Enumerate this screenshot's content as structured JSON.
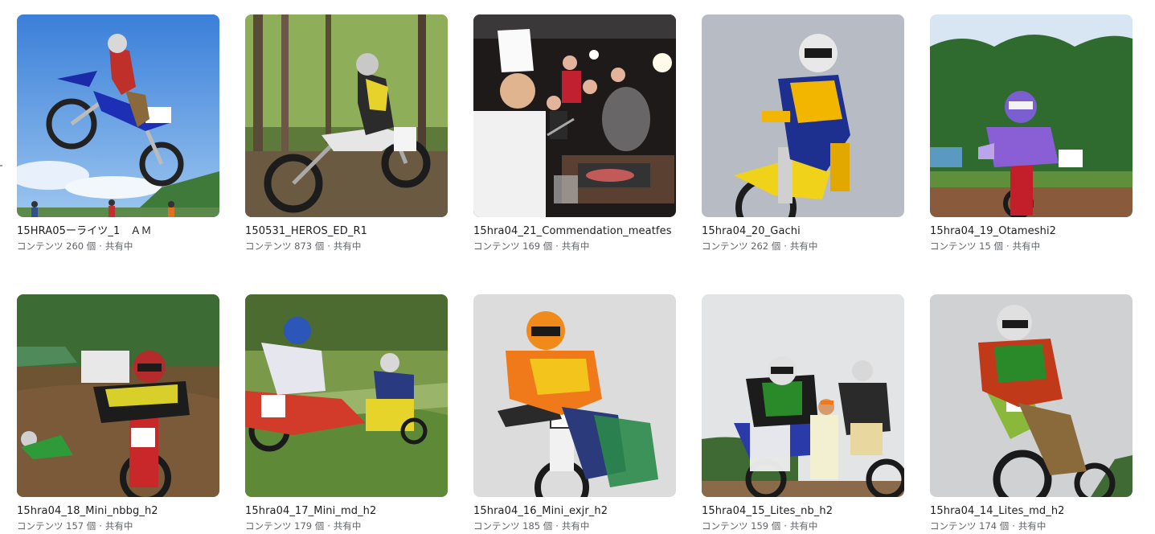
{
  "albums": [
    {
      "title": "15HRA05ーライツ_1　ＡＭ",
      "count_label": "コンテンツ 260 個",
      "status": "共有中",
      "photo": "sky-jump"
    },
    {
      "title": "150531_HEROS_ED_R1",
      "count_label": "コンテンツ 873 個",
      "status": "共有中",
      "photo": "forest-rider"
    },
    {
      "title": "15hra04_21_Commendation_meatfes",
      "count_label": "コンテンツ 169 個",
      "status": "共有中",
      "photo": "bbq-chef"
    },
    {
      "title": "15hra04_20_Gachi",
      "count_label": "コンテンツ 262 個",
      "status": "共有中",
      "photo": "yellow-rider"
    },
    {
      "title": "15hra04_19_Otameshi2",
      "count_label": "コンテンツ 15 個",
      "status": "共有中",
      "photo": "purple-rider"
    },
    {
      "title": "15hra04_18_Mini_nbbg_h2",
      "count_label": "コンテンツ 157 個",
      "status": "共有中",
      "photo": "mini-race"
    },
    {
      "title": "15hra04_17_Mini_md_h2",
      "count_label": "コンテンツ 179 個",
      "status": "共有中",
      "photo": "grass-race"
    },
    {
      "title": "15hra04_16_Mini_exjr_h2",
      "count_label": "コンテンツ 185 個",
      "status": "共有中",
      "photo": "orange-rider"
    },
    {
      "title": "15hra04_15_Lites_nb_h2",
      "count_label": "コンテンツ 159 個",
      "status": "共有中",
      "photo": "lites-pack"
    },
    {
      "title": "15hra04_14_Lites_md_h2",
      "count_label": "コンテンツ 174 個",
      "status": "共有中",
      "photo": "green-rider"
    }
  ],
  "separator": "·"
}
